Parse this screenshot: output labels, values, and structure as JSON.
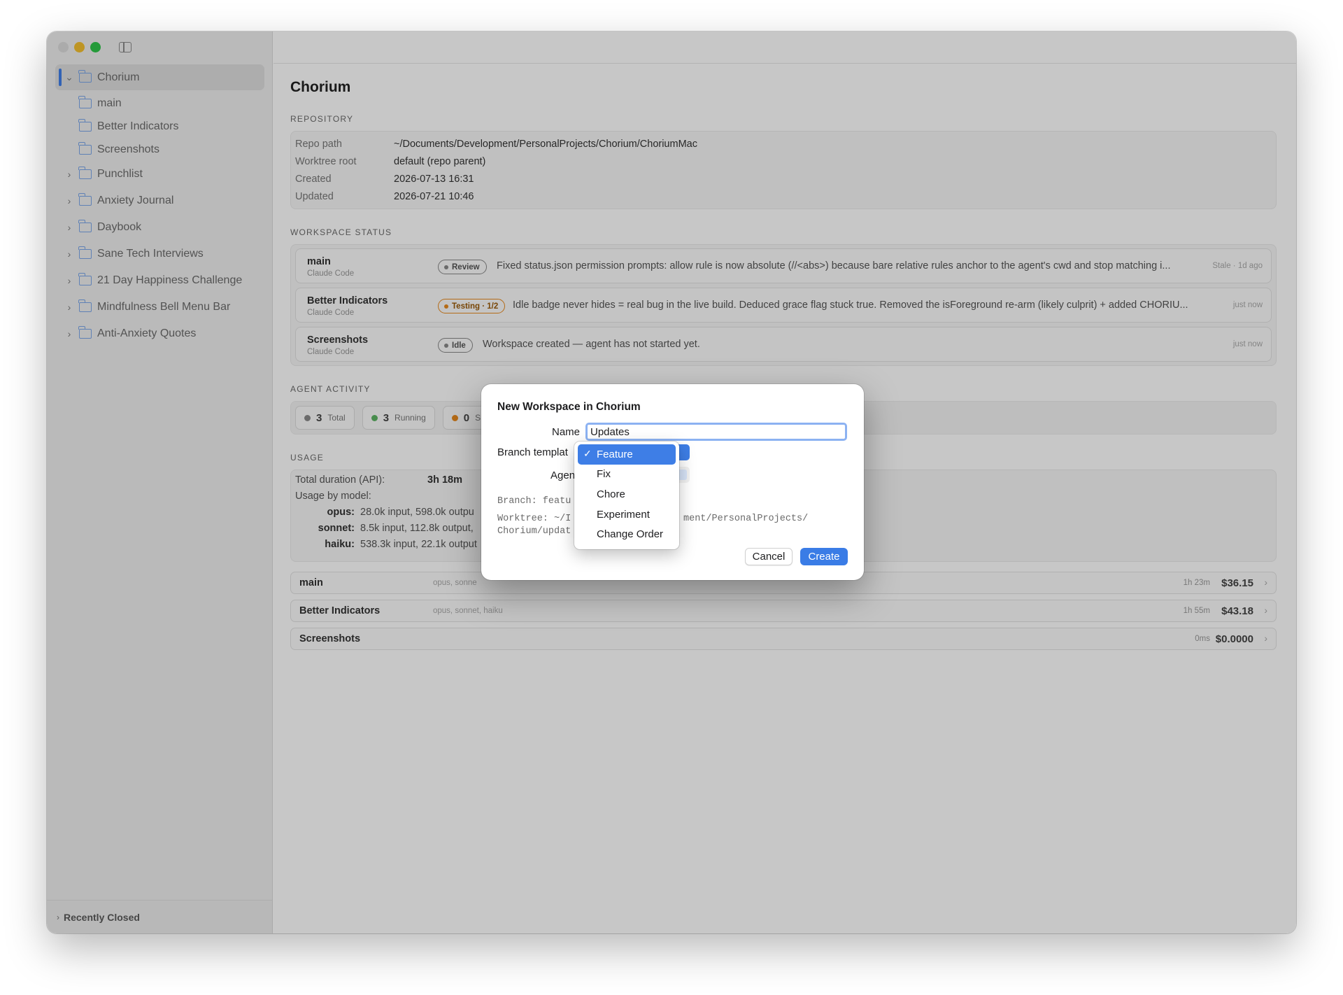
{
  "sidebar": {
    "root": {
      "label": "Chorium"
    },
    "children": [
      {
        "label": "main"
      },
      {
        "label": "Better Indicators"
      },
      {
        "label": "Screenshots"
      }
    ],
    "projects": [
      {
        "label": "Punchlist"
      },
      {
        "label": "Anxiety Journal"
      },
      {
        "label": "Daybook"
      },
      {
        "label": "Sane Tech Interviews"
      },
      {
        "label": "21 Day Happiness Challenge"
      },
      {
        "label": "Mindfulness Bell Menu Bar"
      },
      {
        "label": "Anti-Anxiety Quotes"
      }
    ],
    "recently_closed": "Recently Closed"
  },
  "main": {
    "title": "Chorium",
    "repository": {
      "heading": "REPOSITORY",
      "rows": [
        {
          "key": "Repo path",
          "value": "~/Documents/Development/PersonalProjects/Chorium/ChoriumMac"
        },
        {
          "key": "Worktree root",
          "value": "default (repo parent)"
        },
        {
          "key": "Created",
          "value": "2026-07-13 16:31"
        },
        {
          "key": "Updated",
          "value": "2026-07-21 10:46"
        }
      ]
    },
    "workspace_status": {
      "heading": "WORKSPACE STATUS",
      "rows": [
        {
          "name": "main",
          "agent": "Claude Code",
          "badge": "Review",
          "desc": "Fixed status.json permission prompts: allow rule is now absolute (//<abs>) because bare relative rules anchor to the agent's cwd and stop matching i...",
          "time": "Stale · 1d ago"
        },
        {
          "name": "Better Indicators",
          "agent": "Claude Code",
          "badge": "Testing · 1/2",
          "desc": "Idle badge never hides = real bug in the live build. Deduced grace flag stuck true. Removed the isForeground re-arm (likely culprit) + added CHORIU...",
          "time": "just now"
        },
        {
          "name": "Screenshots",
          "agent": "Claude Code",
          "badge": "Idle",
          "desc": "Workspace created — agent has not started yet.",
          "time": "just now"
        }
      ]
    },
    "agent_activity": {
      "heading": "AGENT ACTIVITY",
      "pills": [
        {
          "num": "3",
          "label": "Total",
          "color": "#8a8a8a"
        },
        {
          "num": "3",
          "label": "Running",
          "color": "#5db463"
        },
        {
          "num": "0",
          "label": "S",
          "color": "#e7891e"
        }
      ]
    },
    "usage": {
      "heading": "USAGE",
      "duration_label": "Total duration (API):",
      "duration_value": "3h 18m",
      "by_model_label": "Usage by model:",
      "models": [
        {
          "name": "opus:",
          "value": "28.0k input, 598.0k outpu"
        },
        {
          "name": "sonnet:",
          "value": "8.5k input, 112.8k output,"
        },
        {
          "name": "haiku:",
          "value": "538.3k input, 22.1k output"
        }
      ],
      "costs": [
        {
          "name": "main",
          "models": "opus, sonne",
          "duration": "1h 23m",
          "cost": "$36.15"
        },
        {
          "name": "Better Indicators",
          "models": "opus, sonnet, haiku",
          "duration": "1h 55m",
          "cost": "$43.18"
        },
        {
          "name": "Screenshots",
          "models": "",
          "duration": "0ms",
          "cost": "$0.0000"
        }
      ]
    }
  },
  "dialog": {
    "title": "New Workspace in Chorium",
    "name_label": "Name",
    "name_value": "Updates",
    "branch_label": "Branch templat",
    "agent_label": "Agen",
    "branch_preview": "Branch: featu",
    "worktree_line1_a": "Worktree: ~/I",
    "worktree_line1_b": "ment/PersonalProjects/",
    "worktree_line2": "Chorium/updat",
    "cancel": "Cancel",
    "create": "Create"
  },
  "menu": {
    "check": "✓",
    "items": [
      {
        "label": "Feature",
        "selected": true
      },
      {
        "label": "Fix"
      },
      {
        "label": "Chore"
      },
      {
        "label": "Experiment"
      },
      {
        "label": "Change Order"
      }
    ]
  },
  "colors": {
    "accent": "#3e7ee6",
    "testing": "#e7891e",
    "running": "#5db463"
  }
}
